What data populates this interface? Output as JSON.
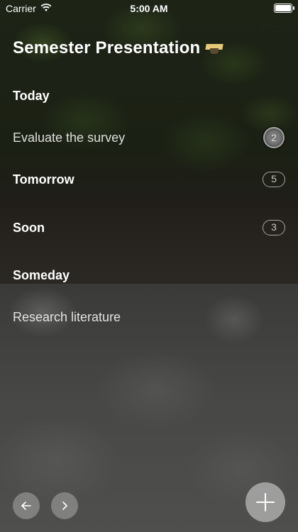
{
  "status_bar": {
    "carrier": "Carrier",
    "time": "5:00 AM"
  },
  "title": {
    "text": "Semester Presentation",
    "icon": "graduation-cap-icon"
  },
  "rows": [
    {
      "kind": "section",
      "label": "Today",
      "badge": ""
    },
    {
      "kind": "task",
      "label": "Evaluate the survey",
      "badge": "2",
      "badge_active": true
    },
    {
      "kind": "section",
      "label": "Tomorrow",
      "badge": "5"
    },
    {
      "kind": "section",
      "label": "Soon",
      "badge": "3"
    },
    {
      "kind": "section",
      "label": "Someday",
      "badge": ""
    },
    {
      "kind": "task",
      "label": "Research literature",
      "badge": ""
    }
  ],
  "toolbar": {
    "back_icon": "arrow-left-icon",
    "forward_icon": "arrow-right-icon",
    "add_icon": "plus-icon"
  }
}
